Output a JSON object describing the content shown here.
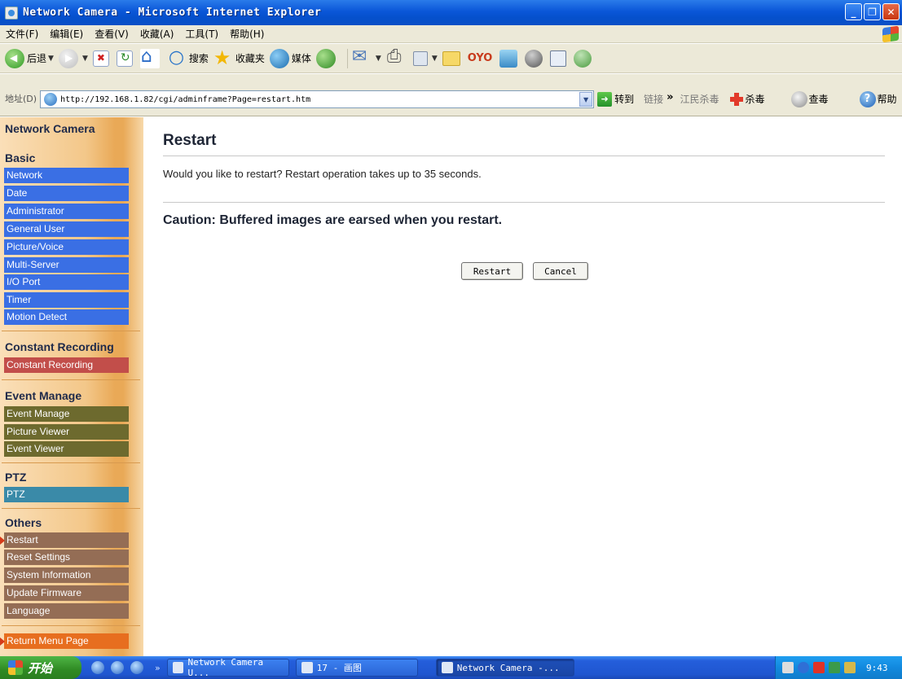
{
  "window": {
    "title": "Network Camera - Microsoft Internet Explorer",
    "controls": [
      "minimize",
      "maximize",
      "close"
    ]
  },
  "menubar": {
    "items": [
      "文件(F)",
      "编辑(E)",
      "查看(V)",
      "收藏(A)",
      "工具(T)",
      "帮助(H)"
    ]
  },
  "toolbar": {
    "back_label": "后退",
    "search_label": "搜索",
    "favorites_label": "收藏夹",
    "media_label": "媒体"
  },
  "addressbar": {
    "label": "地址(D)",
    "url": "http://192.168.1.82/cgi/adminframe?Page=restart.htm",
    "go_label": "转到",
    "links_label": "链接",
    "chevron": "»",
    "jiangmin_label": "江民杀毒",
    "kill_label": "杀毒",
    "scan_label": "查毒",
    "help_label": "帮助"
  },
  "sidebar": {
    "brand": "Network Camera",
    "sections": [
      {
        "heading": "Basic",
        "items": [
          "Network",
          "Date",
          "Administrator",
          "General User",
          "Picture/Voice",
          "Multi-Server",
          "I/O Port",
          "Timer",
          "Motion Detect"
        ]
      },
      {
        "heading": "Constant Recording",
        "items": [
          "Constant Recording"
        ]
      },
      {
        "heading": "Event Manage",
        "items": [
          "Event Manage",
          "Picture Viewer",
          "Event Viewer"
        ]
      },
      {
        "heading": "PTZ",
        "items": [
          "PTZ"
        ]
      },
      {
        "heading": "Others",
        "items": [
          "Restart",
          "Reset Settings",
          "System Information",
          "Update Firmware",
          "Language"
        ]
      }
    ],
    "return_label": "Return Menu Page",
    "active_item": "Restart"
  },
  "main": {
    "title": "Restart",
    "message": "Would you like to restart? Restart operation takes up to 35 seconds.",
    "caution": "Caution: Buffered images are earsed when you restart.",
    "restart_button": "Restart",
    "cancel_button": "Cancel"
  },
  "taskbar": {
    "start_label": "开始",
    "chevron": "»",
    "tasks": [
      "Network Camera U...",
      "17 - 画图",
      "Network Camera -..."
    ],
    "clock": "9:43"
  },
  "colors": {
    "basic_item": "#3a6fe4",
    "recording_item": "#c24e4a",
    "event_item": "#6d6a2e",
    "ptz_item": "#3a8aa8",
    "others_item": "#946d55",
    "return_item": "#e76e1f"
  }
}
